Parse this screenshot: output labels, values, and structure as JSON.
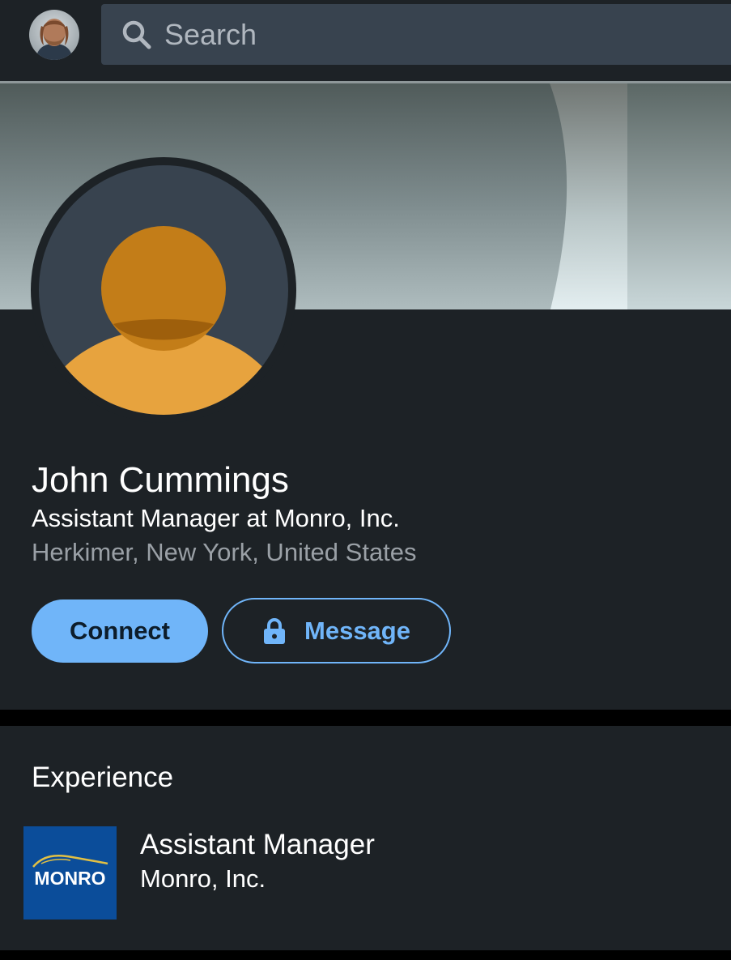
{
  "search": {
    "placeholder": "Search",
    "icon": "search-icon"
  },
  "profile": {
    "name": "John Cummings",
    "headline": "Assistant Manager at Monro, Inc.",
    "location": "Herkimer, New York, United States"
  },
  "actions": {
    "connect_label": "Connect",
    "message_label": "Message",
    "message_icon": "lock-icon"
  },
  "experience": {
    "section_title": "Experience",
    "items": [
      {
        "logo_text": "MONRO",
        "role": "Assistant Manager",
        "company": "Monro, Inc."
      }
    ]
  },
  "colors": {
    "background": "#1d2226",
    "accent": "#70b5f9",
    "search_bg": "#38434f",
    "secondary_text": "#9aa0a6",
    "avatar_placeholder": "#e7a33e",
    "monro_blue": "#0b4d9a"
  }
}
